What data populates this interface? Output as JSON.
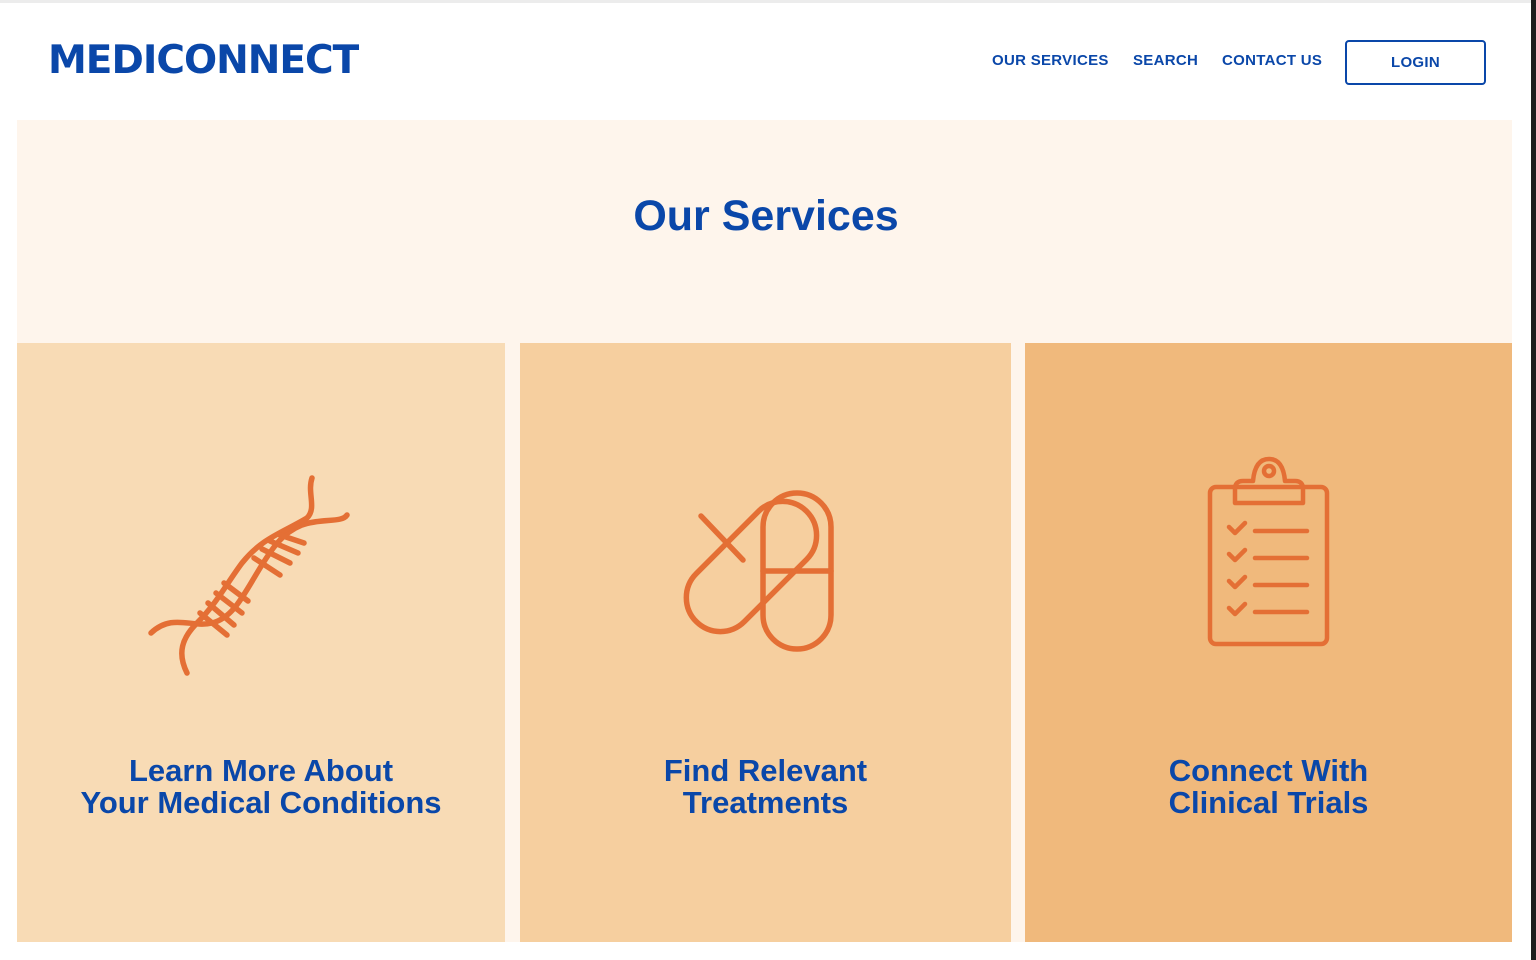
{
  "header": {
    "logo": "MEDICONNECT",
    "nav": {
      "our_services": "OUR SERVICES",
      "search": "SEARCH",
      "contact_us": "CONTACT US"
    },
    "login_label": "LOGIN"
  },
  "services": {
    "title": "Our Services",
    "cards": [
      {
        "line1": "Learn More About",
        "line2": "Your Medical Conditions",
        "icon": "dna-icon",
        "bg_color": "#f8dbb5"
      },
      {
        "line1": "Find Relevant",
        "line2": "Treatments",
        "icon": "pills-icon",
        "bg_color": "#f6cf9f"
      },
      {
        "line1": "Connect With",
        "line2": "Clinical Trials",
        "icon": "clipboard-checklist-icon",
        "bg_color": "#f0b97c"
      }
    ]
  },
  "colors": {
    "brand_blue": "#0a47a9",
    "icon_orange": "#e46f35",
    "section_bg": "#fef5ec"
  }
}
